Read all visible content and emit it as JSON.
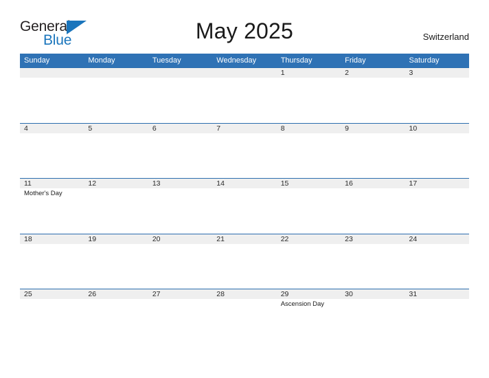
{
  "brand": {
    "name_part1": "General",
    "name_part2": "Blue",
    "flag_icon": "flag-triangle-icon",
    "accent_color": "#1a75bc"
  },
  "header": {
    "title": "May 2025",
    "country": "Switzerland"
  },
  "calendar": {
    "header_bg": "#2f72b5",
    "band_bg": "#efefef",
    "band_border": "#2a6cae",
    "weekdays": [
      "Sunday",
      "Monday",
      "Tuesday",
      "Wednesday",
      "Thursday",
      "Friday",
      "Saturday"
    ],
    "weeks": [
      [
        {
          "day": "",
          "event": ""
        },
        {
          "day": "",
          "event": ""
        },
        {
          "day": "",
          "event": ""
        },
        {
          "day": "",
          "event": ""
        },
        {
          "day": "1",
          "event": ""
        },
        {
          "day": "2",
          "event": ""
        },
        {
          "day": "3",
          "event": ""
        }
      ],
      [
        {
          "day": "4",
          "event": ""
        },
        {
          "day": "5",
          "event": ""
        },
        {
          "day": "6",
          "event": ""
        },
        {
          "day": "7",
          "event": ""
        },
        {
          "day": "8",
          "event": ""
        },
        {
          "day": "9",
          "event": ""
        },
        {
          "day": "10",
          "event": ""
        }
      ],
      [
        {
          "day": "11",
          "event": "Mother's Day"
        },
        {
          "day": "12",
          "event": ""
        },
        {
          "day": "13",
          "event": ""
        },
        {
          "day": "14",
          "event": ""
        },
        {
          "day": "15",
          "event": ""
        },
        {
          "day": "16",
          "event": ""
        },
        {
          "day": "17",
          "event": ""
        }
      ],
      [
        {
          "day": "18",
          "event": ""
        },
        {
          "day": "19",
          "event": ""
        },
        {
          "day": "20",
          "event": ""
        },
        {
          "day": "21",
          "event": ""
        },
        {
          "day": "22",
          "event": ""
        },
        {
          "day": "23",
          "event": ""
        },
        {
          "day": "24",
          "event": ""
        }
      ],
      [
        {
          "day": "25",
          "event": ""
        },
        {
          "day": "26",
          "event": ""
        },
        {
          "day": "27",
          "event": ""
        },
        {
          "day": "28",
          "event": ""
        },
        {
          "day": "29",
          "event": "Ascension Day"
        },
        {
          "day": "30",
          "event": ""
        },
        {
          "day": "31",
          "event": ""
        }
      ]
    ]
  }
}
